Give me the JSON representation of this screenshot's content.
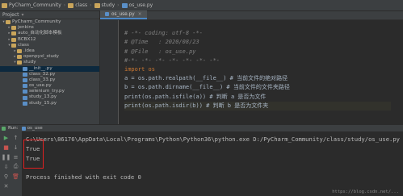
{
  "breadcrumbs": [
    "PyCharm_Community",
    "class",
    "study",
    "os_use.py"
  ],
  "project": {
    "header": "Project",
    "tree": [
      {
        "label": "PyCharm_Community",
        "type": "folder",
        "indent": 0,
        "open": true
      },
      {
        "label": "jenkins",
        "type": "folder",
        "indent": 1,
        "open": false
      },
      {
        "label": "auto_自动化脚本模板",
        "type": "folder",
        "indent": 1,
        "open": false
      },
      {
        "label": "BCBX12",
        "type": "folder",
        "indent": 1,
        "open": false
      },
      {
        "label": "class",
        "type": "folder",
        "indent": 1,
        "open": true
      },
      {
        "label": ".idea",
        "type": "folder",
        "indent": 2,
        "open": false
      },
      {
        "label": "openpyxl_study",
        "type": "folder",
        "indent": 2,
        "open": false
      },
      {
        "label": "study",
        "type": "folder",
        "indent": 2,
        "open": true
      },
      {
        "label": "__init__.py",
        "type": "py",
        "indent": 3,
        "selected": true
      },
      {
        "label": "class_32.py",
        "type": "py",
        "indent": 3
      },
      {
        "label": "class_33.py",
        "type": "py",
        "indent": 3
      },
      {
        "label": "os_use.py",
        "type": "py",
        "indent": 3
      },
      {
        "label": "selenium_try.py",
        "type": "py",
        "indent": 3
      },
      {
        "label": "study_13.py",
        "type": "py",
        "indent": 3
      },
      {
        "label": "study_15.py",
        "type": "py",
        "indent": 3
      }
    ]
  },
  "editor": {
    "tab_label": "os_use.py",
    "lines": [
      "# -*- coding: utf-8 -*-",
      "# @Time   : 2020/08/23",
      "# @File   : os_use.py",
      "#-*- -*- -*- -*- -*- -*- -*-",
      "import os",
      "a = os.path.realpath(__file__) # 当前文件的绝对路径",
      "b = os.path.dirname(__file__) # 当前文件的文件夹路径",
      "print(os.path.isfile(a)) # 判断 a 是否为文件",
      "print(os.path.isdir(b)) # 判断 b 是否为文件夹"
    ]
  },
  "run": {
    "tab_label": "Run:",
    "config_label": "os_use",
    "command": "C:\\Users\\86176\\AppData\\Local\\Programs\\Python\\Python36\\python.exe D:/PyCharm_Community/class/study/os_use.py",
    "output": [
      "True",
      "True"
    ],
    "exit_message": "Process finished with exit code 0",
    "watermark": "https://blog.csdn.net/..."
  }
}
